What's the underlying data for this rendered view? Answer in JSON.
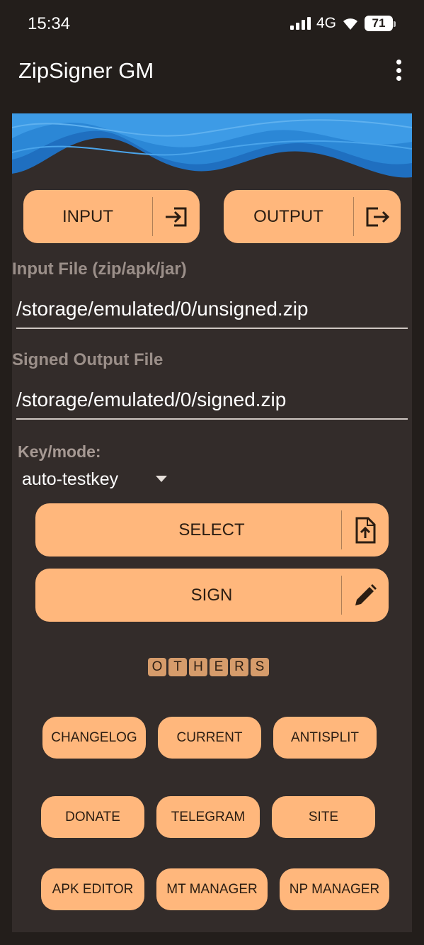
{
  "status": {
    "time": "15:34",
    "network": "4G",
    "battery": "71"
  },
  "app": {
    "title": "ZipSigner GM",
    "overflow_icon": "more-vert-icon"
  },
  "colors": {
    "accent": "#ffb77c",
    "background": "#231e1b",
    "surface": "#332c2a",
    "banner_blue": "#2b87d6"
  },
  "top_buttons": {
    "input": {
      "label": "INPUT",
      "icon": "input-arrow-icon"
    },
    "output": {
      "label": "OUTPUT",
      "icon": "output-arrow-icon"
    }
  },
  "input_file": {
    "label": "Input File (zip/apk/jar)",
    "value": "/storage/emulated/0/unsigned.zip"
  },
  "output_file": {
    "label": "Signed Output File",
    "value": "/storage/emulated/0/signed.zip"
  },
  "key_mode": {
    "label": "Key/mode:",
    "selected": "auto-testkey"
  },
  "actions": {
    "select": {
      "label": "SELECT",
      "icon": "file-upload-icon"
    },
    "sign": {
      "label": "SIGN",
      "icon": "pencil-icon"
    }
  },
  "others_letters": [
    "O",
    "T",
    "H",
    "E",
    "R",
    "S"
  ],
  "links": {
    "changelog": "CHANGELOG",
    "current": "CURRENT",
    "antisplit": "ANTISPLIT",
    "donate": "DONATE",
    "telegram": "TELEGRAM",
    "site": "SITE",
    "apk_editor": "APK EDITOR",
    "mt_manager": "MT MANAGER",
    "np_manager": "NP MANAGER"
  }
}
